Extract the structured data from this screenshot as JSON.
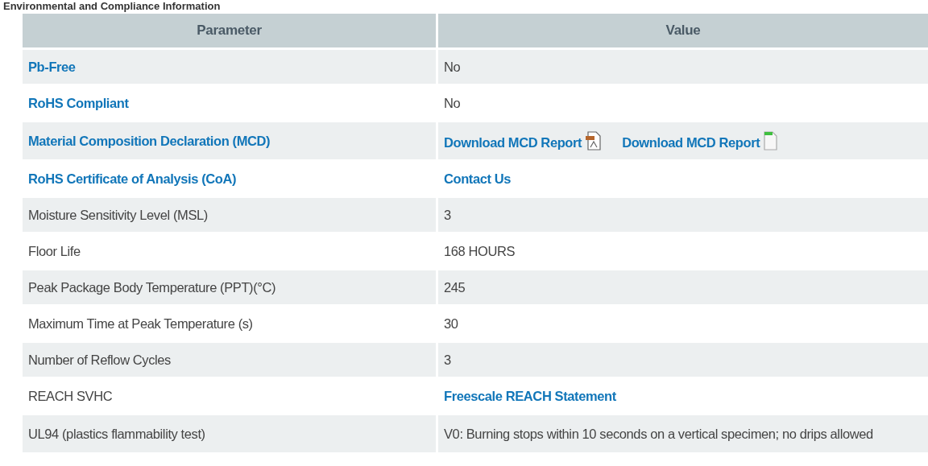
{
  "section_title": "Environmental and Compliance Information",
  "columns": [
    "Parameter",
    "Value"
  ],
  "rows": [
    {
      "parameter": {
        "text": "Pb-Free",
        "kind": "link"
      },
      "value": [
        {
          "text": "No",
          "kind": "text"
        }
      ]
    },
    {
      "parameter": {
        "text": "RoHS Compliant",
        "kind": "link"
      },
      "value": [
        {
          "text": "No",
          "kind": "text"
        }
      ]
    },
    {
      "parameter": {
        "text": "Material Composition Declaration (MCD)",
        "kind": "link"
      },
      "value": [
        {
          "text": "Download MCD Report",
          "kind": "pdf_link"
        },
        {
          "text": "Download MCD Report",
          "kind": "file_link"
        }
      ]
    },
    {
      "parameter": {
        "text": "RoHS Certificate of Analysis (CoA)",
        "kind": "link"
      },
      "value": [
        {
          "text": "Contact Us",
          "kind": "link"
        }
      ]
    },
    {
      "parameter": {
        "text": "Moisture Sensitivity Level (MSL)",
        "kind": "text"
      },
      "value": [
        {
          "text": "3",
          "kind": "text"
        }
      ]
    },
    {
      "parameter": {
        "text": "Floor Life",
        "kind": "text"
      },
      "value": [
        {
          "text": "168 HOURS",
          "kind": "text"
        }
      ]
    },
    {
      "parameter": {
        "text": "Peak Package Body Temperature (PPT)(°C)",
        "kind": "text"
      },
      "value": [
        {
          "text": "245",
          "kind": "text"
        }
      ]
    },
    {
      "parameter": {
        "text": "Maximum Time at Peak Temperature (s)",
        "kind": "text"
      },
      "value": [
        {
          "text": "30",
          "kind": "text"
        }
      ]
    },
    {
      "parameter": {
        "text": "Number of Reflow Cycles",
        "kind": "text"
      },
      "value": [
        {
          "text": "3",
          "kind": "text"
        }
      ]
    },
    {
      "parameter": {
        "text": "REACH SVHC",
        "kind": "text"
      },
      "value": [
        {
          "text": "Freescale REACH Statement",
          "kind": "link"
        }
      ]
    },
    {
      "parameter": {
        "text": "UL94 (plastics flammability test)",
        "kind": "text"
      },
      "value": [
        {
          "text": "V0: Burning stops within 10 seconds on a vertical specimen; no drips allowed",
          "kind": "text"
        }
      ]
    }
  ]
}
